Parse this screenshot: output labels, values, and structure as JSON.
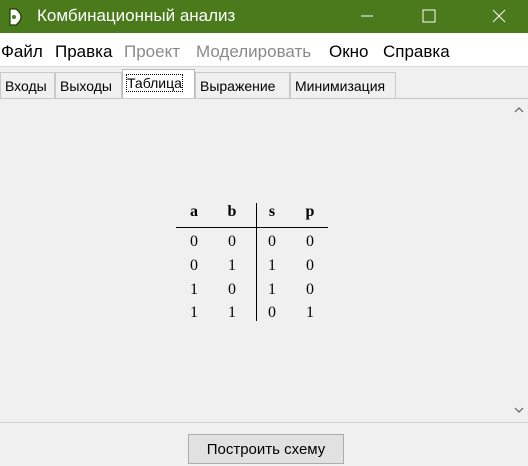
{
  "window": {
    "title": "Комбинационный анализ",
    "accent_color": "#4a7a1b",
    "controls": [
      "minimize-icon",
      "maximize-icon",
      "close-icon"
    ]
  },
  "menu": {
    "items": [
      {
        "label": "Файл",
        "enabled": true
      },
      {
        "label": "Правка",
        "enabled": true
      },
      {
        "label": "Проект",
        "enabled": false
      },
      {
        "label": "Моделировать",
        "enabled": false
      },
      {
        "label": "Окно",
        "enabled": true
      },
      {
        "label": "Справка",
        "enabled": true
      }
    ]
  },
  "tabs": {
    "items": [
      {
        "label": "Входы"
      },
      {
        "label": "Выходы"
      },
      {
        "label": "Таблица"
      },
      {
        "label": "Выражение"
      },
      {
        "label": "Минимизация"
      }
    ],
    "active": "Таблица"
  },
  "truth_table": {
    "headers": [
      "a",
      "b",
      "s",
      "p"
    ],
    "rows": [
      [
        "0",
        "0",
        "0",
        "0"
      ],
      [
        "0",
        "1",
        "1",
        "0"
      ],
      [
        "1",
        "0",
        "1",
        "0"
      ],
      [
        "1",
        "1",
        "0",
        "1"
      ]
    ]
  },
  "footer": {
    "build_button": "Построить схему"
  }
}
